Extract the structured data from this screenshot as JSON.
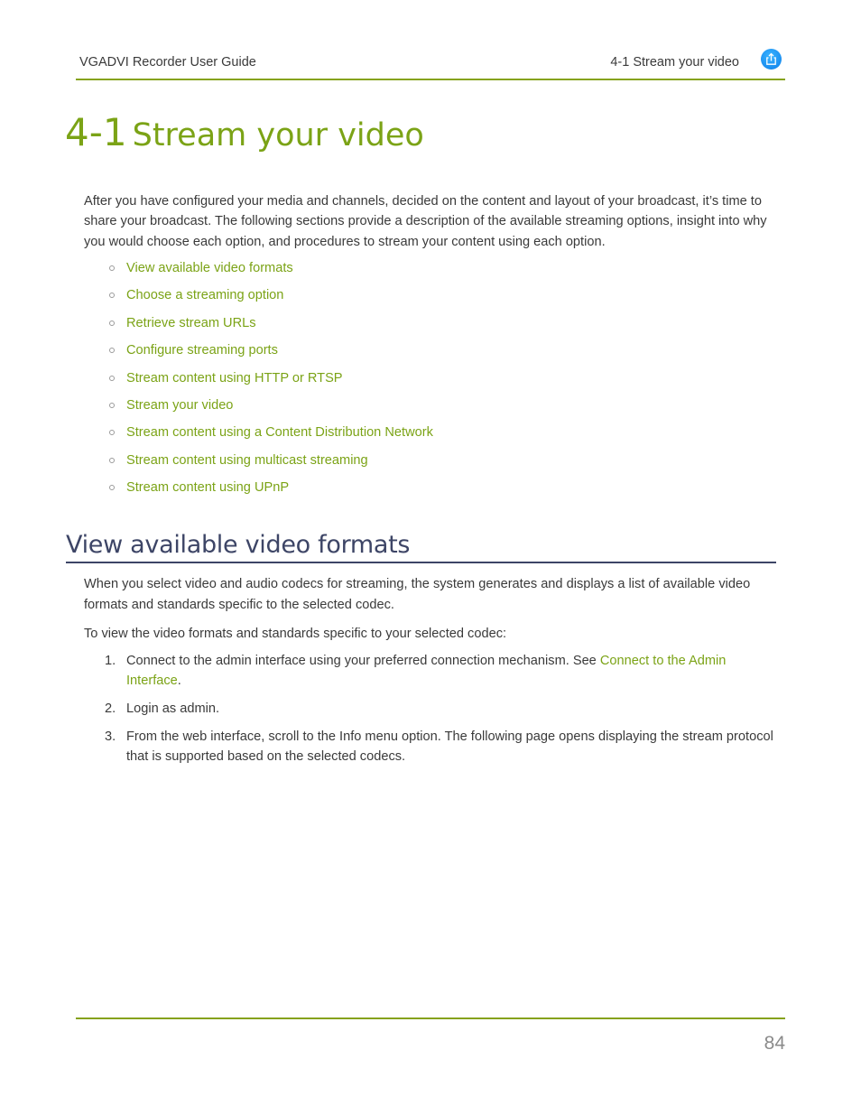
{
  "header": {
    "doc_title": "VGADVI Recorder User Guide",
    "section_title": "4-1 Stream your video",
    "share_icon": "share-export-icon",
    "accent_color": "#86a21c"
  },
  "title": {
    "number": "4-1",
    "text": "Stream your video",
    "color": "#7ba316"
  },
  "intro": "After you have configured your media and channels, decided on the content and layout of your broadcast, it’s time to share your broadcast. The following sections provide a description of the available streaming options, insight into why you would choose each option, and procedures to stream your content using each option.",
  "toc": [
    {
      "label": "View available video formats"
    },
    {
      "label": "Choose a streaming option"
    },
    {
      "label": "Retrieve stream URLs"
    },
    {
      "label": "Configure streaming ports"
    },
    {
      "label": "Stream content using HTTP or RTSP"
    },
    {
      "label": "Stream your video"
    },
    {
      "label": "Stream content using a Content Distribution Network"
    },
    {
      "label": "Stream content using multicast streaming"
    },
    {
      "label": "Stream content using UPnP"
    }
  ],
  "section": {
    "heading": "View available video formats",
    "heading_color": "#3d4566",
    "para1": "When you select video and audio codecs for streaming, the system generates and displays a list of available video formats and standards specific to the selected codec.",
    "para2": "To view the video formats and standards specific to your selected codec:",
    "steps": [
      {
        "num": "1.",
        "text": "Connect to the admin interface using your preferred connection mechanism. See ",
        "link": "Connect to the Admin Interface",
        "after": "."
      },
      {
        "num": "2.",
        "text": "Login as admin."
      },
      {
        "num": "3.",
        "text": "From the web interface, scroll to the Info menu option. The following page opens displaying the stream protocol that is supported based on the selected codecs."
      }
    ]
  },
  "footer": {
    "page_number": "84"
  }
}
